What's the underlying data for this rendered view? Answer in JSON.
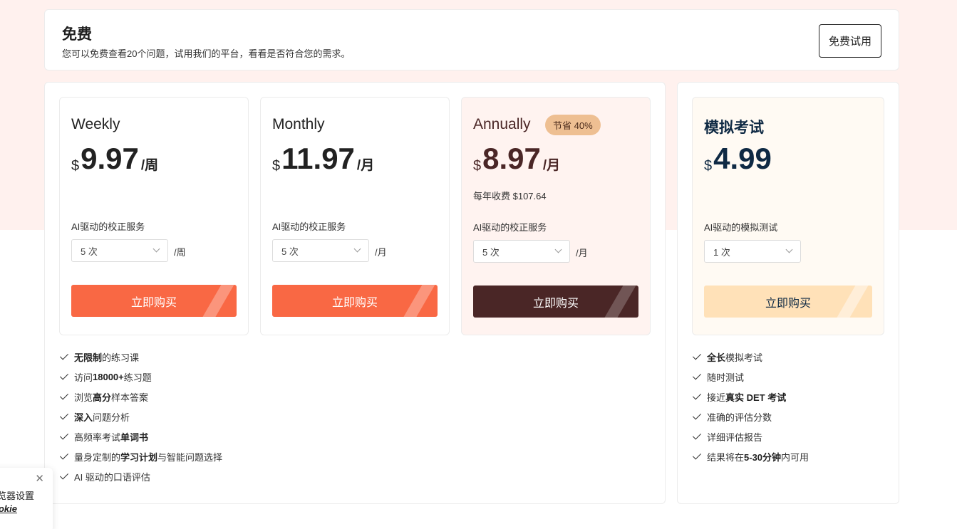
{
  "free": {
    "title": "免费",
    "desc": "您可以免费查看20个问题，试用我们的平台，看看是否符合您的需求。",
    "button": "免费试用"
  },
  "plans": [
    {
      "name": "Weekly",
      "currency": "$",
      "amount": "9.97",
      "per": "/周",
      "service_label": "AI驱动的校正服务",
      "select_value": "5 次",
      "unit": "/周",
      "buy": "立即购买"
    },
    {
      "name": "Monthly",
      "currency": "$",
      "amount": "11.97",
      "per": "/月",
      "service_label": "AI驱动的校正服务",
      "select_value": "5 次",
      "unit": "/月",
      "buy": "立即购买"
    },
    {
      "name": "Annually",
      "badge": "节省 40%",
      "currency": "$",
      "amount": "8.97",
      "per": "/月",
      "yearly": "每年收费 $107.64",
      "service_label": "AI驱动的校正服务",
      "select_value": "5 次",
      "unit": "/月",
      "buy": "立即购买"
    }
  ],
  "mock": {
    "name": "模拟考试",
    "currency": "$",
    "amount": "4.99",
    "service_label": "AI驱动的模拟测试",
    "select_value": "1 次",
    "buy": "立即购买"
  },
  "features": [
    {
      "bold": "无限制",
      "text": "的练习课"
    },
    {
      "pre": "访问 ",
      "bold": "18000+",
      "text": " 练习题"
    },
    {
      "pre": "浏览 ",
      "bold": "高分",
      "text": " 样本答案"
    },
    {
      "bold": "深入",
      "text": " 问题分析"
    },
    {
      "pre": "高频率考试",
      "bold": "单词书",
      "text": ""
    },
    {
      "pre": "量身定制的",
      "bold": "学习计划",
      "text": "与智能问题选择"
    },
    {
      "pre": "AI 驱动的口语评估",
      "bold": "",
      "text": ""
    }
  ],
  "mock_features": [
    {
      "bold": "全长",
      "text": " 模拟考试"
    },
    {
      "pre": "随时测试",
      "bold": "",
      "text": ""
    },
    {
      "pre": "接近 ",
      "bold": "真实 DET 考试",
      "text": ""
    },
    {
      "pre": "准确的评估分数",
      "bold": "",
      "text": ""
    },
    {
      "pre": "详细评估报告",
      "bold": "",
      "text": ""
    },
    {
      "pre": "结果将在",
      "bold": "5-30分钟",
      "text": "内可用"
    }
  ],
  "cookie": {
    "text": "览器设置",
    "link": "ookie"
  },
  "colors": {
    "accent_orange": "#f96844",
    "dark_brown": "#4a2626",
    "peach": "#ffe1b8",
    "navy": "#0f2a44",
    "badge": "#eebf92"
  }
}
